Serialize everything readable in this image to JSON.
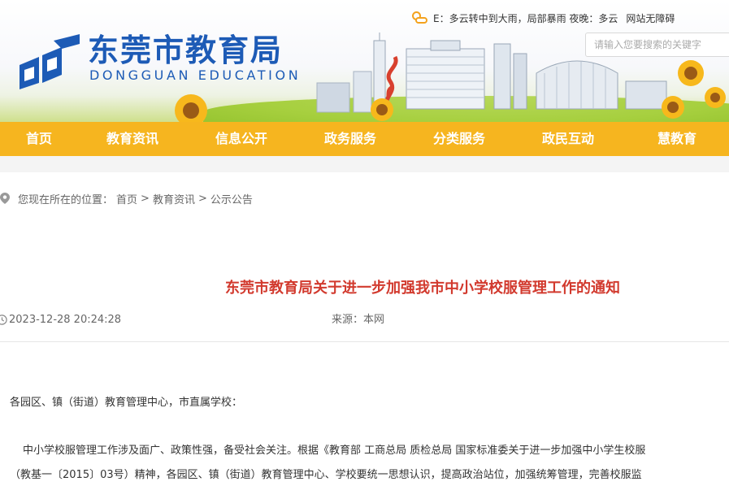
{
  "header": {
    "weather_text": "E：多云转中到大雨，局部暴雨 夜晚：多云",
    "accessibility_link": "网站无障碍",
    "search_placeholder": "请输入您要搜索的关键字",
    "logo_cn": "东莞市教育局",
    "logo_en": "DONGGUAN EDUCATION"
  },
  "nav": {
    "items": [
      "首页",
      "教育资讯",
      "信息公开",
      "政务服务",
      "分类服务",
      "政民互动",
      "慧教育"
    ]
  },
  "breadcrumb": {
    "prefix": "您现在所在的位置：",
    "items": [
      "首页",
      "教育资讯",
      "公示公告"
    ],
    "separator": ">"
  },
  "article": {
    "title": "东莞市教育局关于进一步加强我市中小学校服管理工作的通知",
    "date": "2023-12-28 20:24:28",
    "source": "来源：本网",
    "salutation": "各园区、镇（街道）教育管理中心，市直属学校：",
    "paragraph_1": "中小学校服管理工作涉及面广、政策性强，备受社会关注。根据《教育部 工商总局 质检总局 国家标准委关于进一步加强中小学生校服",
    "paragraph_2": "（教基一〔2015〕03号）精神，各园区、镇（街道）教育管理中心、学校要统一思想认识，提高政治站位，加强统筹管理，完善校服监"
  },
  "colors": {
    "brand_blue": "#1d5bb6",
    "nav_orange": "#f6b51f",
    "title_red": "#d23a2e"
  }
}
